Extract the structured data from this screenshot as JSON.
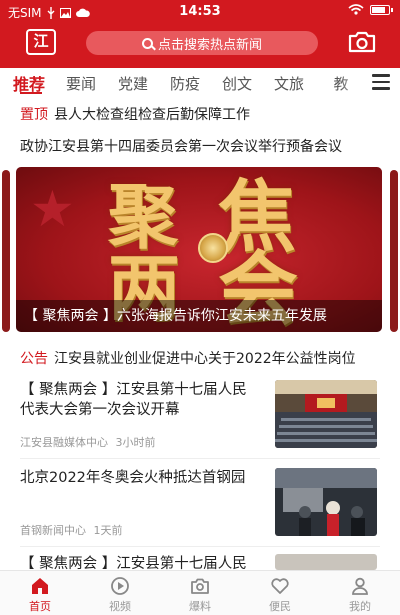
{
  "status_bar": {
    "carrier": "无SIM",
    "time": "14:53"
  },
  "header": {
    "logo_text": "江",
    "search_placeholder": "点击搜索热点新闻"
  },
  "tabs": [
    {
      "label": "推荐",
      "active": true
    },
    {
      "label": "要闻"
    },
    {
      "label": "党建"
    },
    {
      "label": "防疫"
    },
    {
      "label": "创文"
    },
    {
      "label": "文旅"
    },
    {
      "label": "教"
    }
  ],
  "top_items": [
    {
      "tag": "置顶",
      "title": "县人大检查组检查后勤保障工作"
    },
    {
      "tag": "",
      "title": "政协江安县第十四届委员会第一次会议举行预备会议"
    }
  ],
  "banner": {
    "big_text": [
      "聚",
      "焦",
      "两",
      "会"
    ],
    "caption": "【 聚焦两会 】六张海报告诉你江安未来五年发展"
  },
  "notice": {
    "tag": "公告",
    "title": "江安县就业创业促进中心关于2022年公益性岗位"
  },
  "news": [
    {
      "title": "【 聚焦两会 】江安县第十七届人民代表大会第一次会议开幕",
      "source": "江安县融媒体中心",
      "time": "3小时前"
    },
    {
      "title": "北京2022年冬奥会火种抵达首钢园",
      "source": "首钢新闻中心",
      "time": "1天前"
    },
    {
      "title": "【 聚焦两会 】江安县第十七届人民"
    }
  ],
  "bottom_nav": [
    {
      "label": "首页",
      "icon": "home-icon",
      "active": true
    },
    {
      "label": "视频",
      "icon": "play-icon"
    },
    {
      "label": "爆料",
      "icon": "camera-icon"
    },
    {
      "label": "便民",
      "icon": "heart-icon"
    },
    {
      "label": "我的",
      "icon": "user-icon"
    }
  ],
  "colors": {
    "brand": "#d2191f",
    "inactive": "#999999"
  }
}
